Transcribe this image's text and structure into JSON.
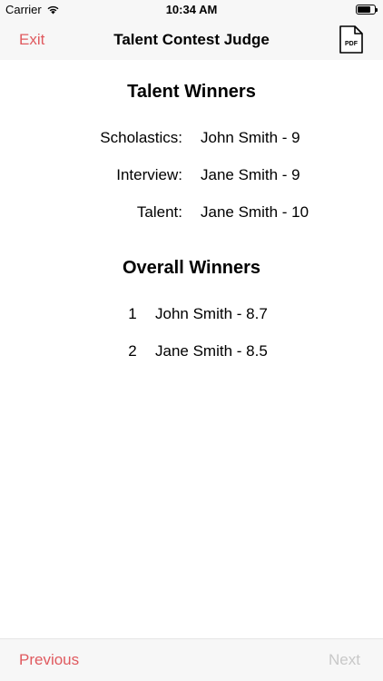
{
  "status_bar": {
    "carrier": "Carrier",
    "time": "10:34 AM",
    "battery_level": 0.8
  },
  "nav": {
    "exit_label": "Exit",
    "title": "Talent Contest Judge",
    "pdf_label": "PDF"
  },
  "talent_winners": {
    "title": "Talent Winners",
    "rows": [
      {
        "label": "Scholastics:",
        "value": "John Smith - 9"
      },
      {
        "label": "Interview:",
        "value": "Jane Smith - 9"
      },
      {
        "label": "Talent:",
        "value": "Jane Smith - 10"
      }
    ]
  },
  "overall_winners": {
    "title": "Overall Winners",
    "rows": [
      {
        "rank": "1",
        "value": "John Smith - 8.7"
      },
      {
        "rank": "2",
        "value": "Jane Smith - 8.5"
      }
    ]
  },
  "toolbar": {
    "previous_label": "Previous",
    "next_label": "Next"
  },
  "colors": {
    "accent": "#e05a5f",
    "disabled": "#c8c8c8"
  }
}
